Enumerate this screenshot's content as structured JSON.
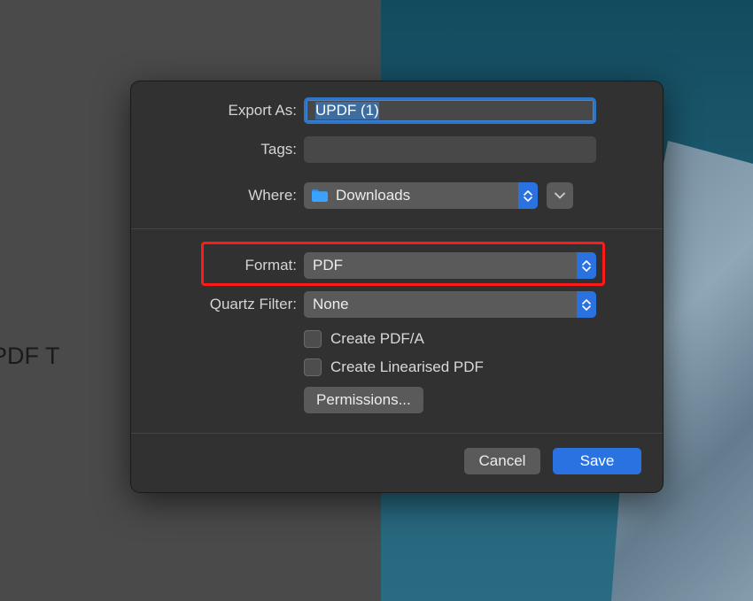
{
  "background": {
    "left_text": "st AI PDF T"
  },
  "dialog": {
    "export_as_label": "Export As:",
    "export_as_value": "UPDF (1)",
    "tags_label": "Tags:",
    "tags_value": "",
    "where_label": "Where:",
    "where_value": "Downloads",
    "format_label": "Format:",
    "format_value": "PDF",
    "quartz_label": "Quartz Filter:",
    "quartz_value": "None",
    "checkbox_pdfa": "Create PDF/A",
    "checkbox_linearised": "Create Linearised PDF",
    "permissions_button": "Permissions...",
    "cancel": "Cancel",
    "save": "Save"
  },
  "colors": {
    "accent": "#2a72e0",
    "highlight": "#ff1a1a"
  }
}
